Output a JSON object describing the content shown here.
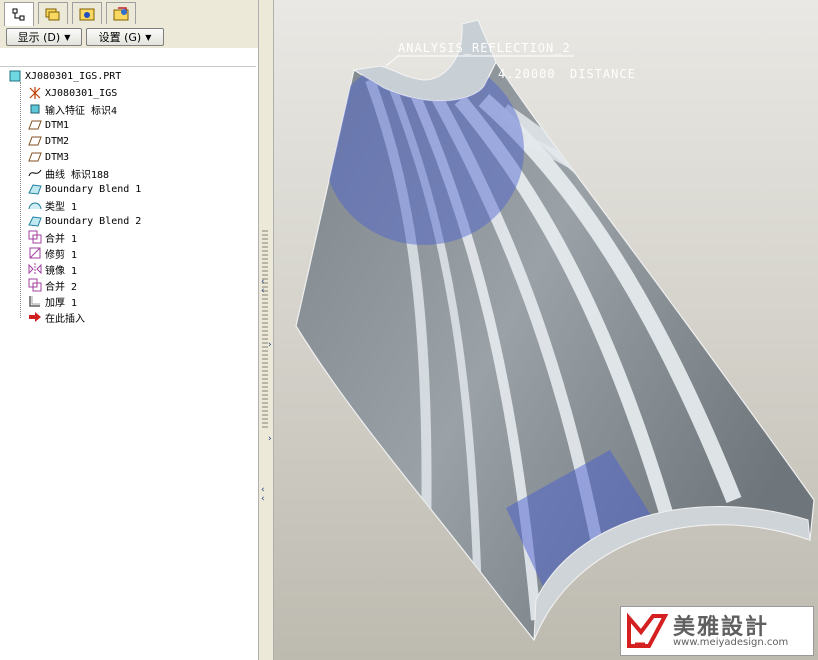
{
  "toolbar": {
    "show_label": "显示 (D)",
    "settings_label": "设置 (G)"
  },
  "tree": {
    "root": "XJ080301_IGS.PRT",
    "items": [
      {
        "label": "XJ080301_IGS",
        "icon": "csys-icon"
      },
      {
        "label": "输入特征 标识4",
        "icon": "import-feature-icon"
      },
      {
        "label": "DTM1",
        "icon": "datum-plane-icon"
      },
      {
        "label": "DTM2",
        "icon": "datum-plane-icon"
      },
      {
        "label": "DTM3",
        "icon": "datum-plane-icon"
      },
      {
        "label": "曲线 标识188",
        "icon": "curve-icon"
      },
      {
        "label": "Boundary Blend 1",
        "icon": "boundary-blend-icon"
      },
      {
        "label": "类型 1",
        "icon": "surface-icon"
      },
      {
        "label": "Boundary Blend 2",
        "icon": "boundary-blend-icon"
      },
      {
        "label": "合并 1",
        "icon": "merge-icon"
      },
      {
        "label": "修剪 1",
        "icon": "trim-icon"
      },
      {
        "label": "镜像 1",
        "icon": "mirror-icon"
      },
      {
        "label": "合并 2",
        "icon": "merge-icon"
      },
      {
        "label": "加厚 1",
        "icon": "thicken-icon"
      },
      {
        "label": "在此插入",
        "icon": "insert-arrow-icon"
      }
    ]
  },
  "viewport": {
    "analysis_name": "ANALYSIS_REFLECTION_2",
    "distance_value": "4.20000",
    "distance_label": "DISTANCE"
  },
  "watermark": {
    "site": "www.meiyadesign.com",
    "brand": "美雅設計"
  },
  "colors": {
    "model_gray": "#8a9298",
    "stripe_light": "#e8ecef",
    "highlight_blue": "#4a5fd0",
    "logo_red": "#d42020"
  }
}
